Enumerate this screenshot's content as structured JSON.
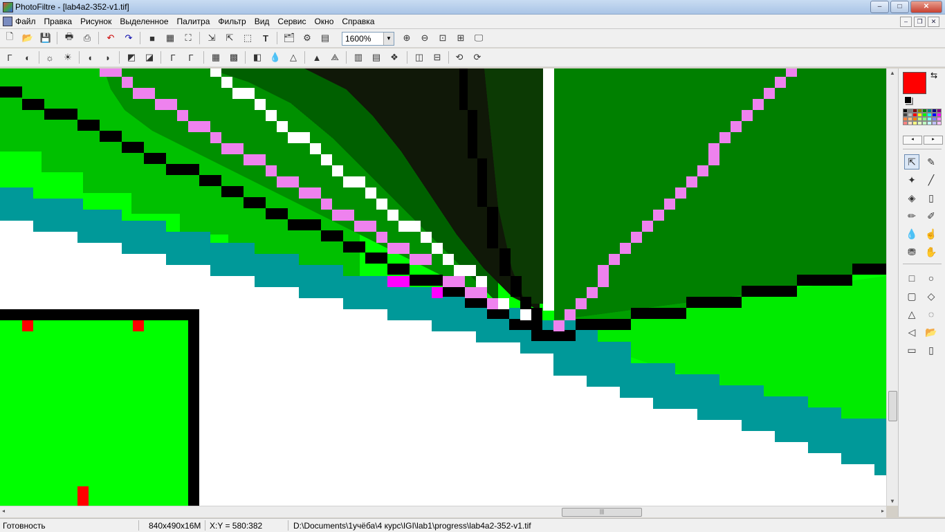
{
  "window": {
    "title": "PhotoFiltre - [lab4a2-352-v1.tif]",
    "controls": {
      "minimize": "–",
      "maximize": "□",
      "close": "✕"
    }
  },
  "menubar": {
    "items": [
      "Файл",
      "Правка",
      "Рисунок",
      "Выделенное",
      "Палитра",
      "Фильтр",
      "Вид",
      "Сервис",
      "Окно",
      "Справка"
    ],
    "mdi": {
      "minimize": "–",
      "restore": "❐",
      "close": "✕"
    }
  },
  "toolbar": {
    "zoom_value": "1600%",
    "zoom_dropdown": "▼"
  },
  "colors": {
    "foreground": "#ff0000",
    "background": "#ffffff",
    "palette": [
      "#000000",
      "#808080",
      "#800000",
      "#808000",
      "#008000",
      "#008080",
      "#000080",
      "#800080",
      "#404040",
      "#c0c0c0",
      "#ff0000",
      "#ffff00",
      "#00ff00",
      "#00ffff",
      "#0000ff",
      "#ff00ff",
      "#ff8040",
      "#ffc080",
      "#ff8000",
      "#c0ff80",
      "#80ff80",
      "#80ffff",
      "#8080ff",
      "#ff80ff",
      "#ff8080",
      "#ffe0c0",
      "#ffff80",
      "#e0ffc0",
      "#c0ffc0",
      "#c0ffff",
      "#c0c0ff",
      "#ffc0ff"
    ],
    "palette_prev": "◂",
    "palette_next": "▸"
  },
  "scrollbars": {
    "vertical": {
      "up": "▲",
      "down": "▼"
    },
    "horizontal": {
      "left": "◂",
      "right": "▸",
      "grip": "|||"
    }
  },
  "statusbar": {
    "state": "Готовность",
    "image_size": "840x490x16M",
    "coords": "X:Y = 580:382",
    "path": "D:\\Documents\\1учёба\\4 курс\\IGI\\lab1\\progress\\lab4a2-352-v1.tif"
  }
}
